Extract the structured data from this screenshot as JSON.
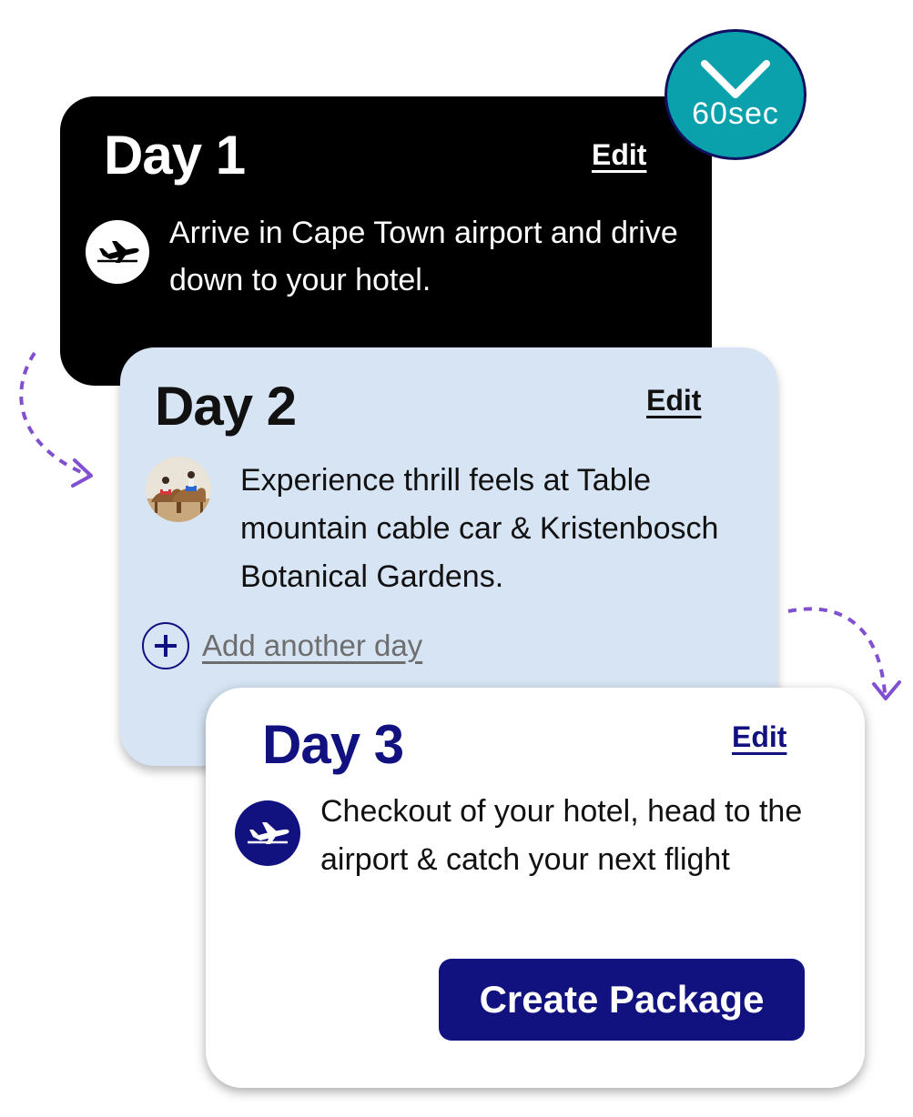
{
  "badge": {
    "label": "60sec",
    "icon": "checkmark-icon",
    "color": "#0aa1ad"
  },
  "days": [
    {
      "title": "Day 1",
      "edit_label": "Edit",
      "icon": "airplane-icon",
      "description": "Arrive in Cape Town airport and drive down to your hotel.",
      "background": "#000000"
    },
    {
      "title": "Day 2",
      "edit_label": "Edit",
      "icon": "camel-ride-photo",
      "description": "Experience thrill feels at Table mountain cable car & Kristenbosch Botanical Gardens.",
      "background": "#d6e4f4"
    },
    {
      "title": "Day 3",
      "edit_label": "Edit",
      "icon": "airplane-icon",
      "description": "Checkout of your hotel, head to the airport & catch your next flight",
      "background": "#ffffff"
    }
  ],
  "add_day": {
    "label": "Add another day",
    "icon": "plus-circle-icon"
  },
  "create_button": {
    "label": "Create Package",
    "color": "#111180"
  },
  "accent_arrow_color": "#8050d0"
}
